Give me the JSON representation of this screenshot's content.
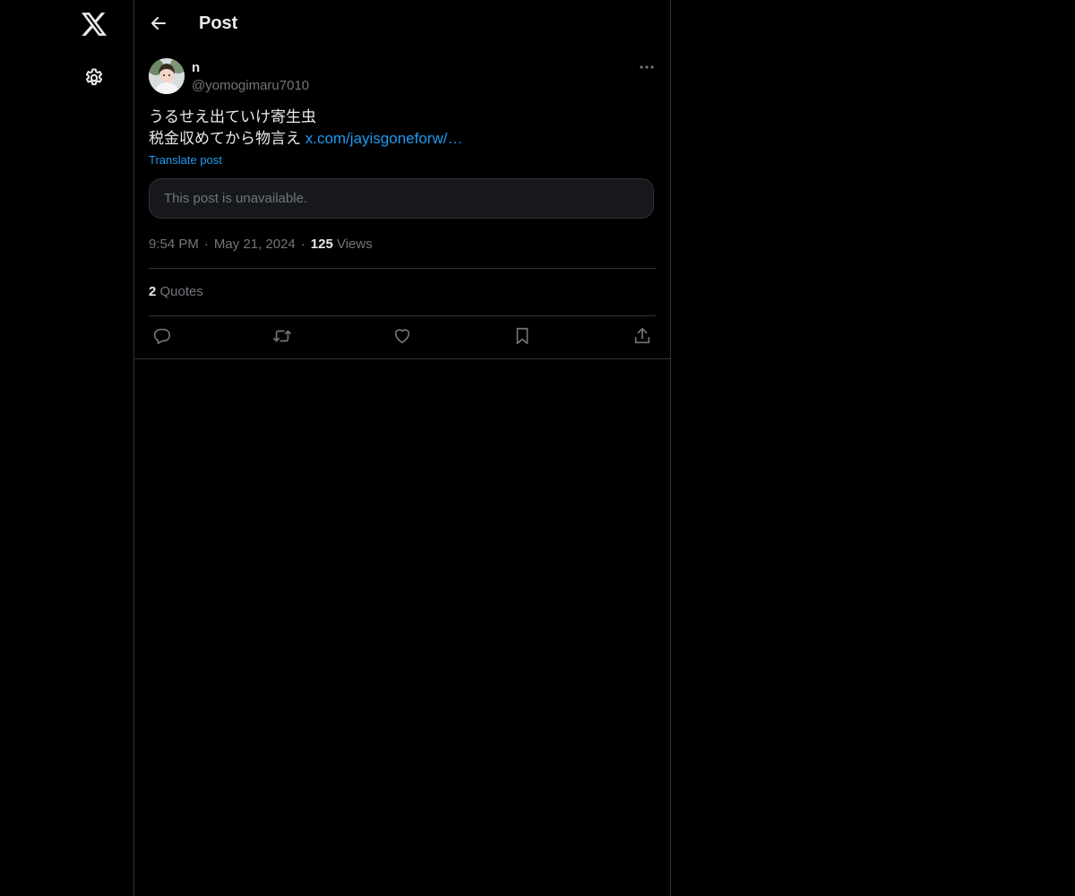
{
  "nav": {
    "logo_icon": "x-logo-icon",
    "settings_icon": "gear-icon"
  },
  "header": {
    "back_icon": "arrow-left-icon",
    "title": "Post"
  },
  "post": {
    "display_name": "n",
    "handle": "@yomogimaru7010",
    "text_line1": "うるせえ出ていけ寄生虫",
    "text_line2": "税金収めてから物言え",
    "link_text": "x.com/jayisgoneforw/…",
    "translate_label": "Translate post",
    "quoted_unavailable": "This post is unavailable.",
    "time": "9:54 PM",
    "date": "May 21, 2024",
    "separator": "·",
    "views_count": "125",
    "views_label": "Views",
    "quotes_count": "2",
    "quotes_label": "Quotes"
  },
  "actions": {
    "reply_icon": "reply-icon",
    "repost_icon": "repost-icon",
    "like_icon": "heart-icon",
    "bookmark_icon": "bookmark-icon",
    "share_icon": "share-icon"
  },
  "colors": {
    "background": "#000000",
    "text_primary": "#e7e9ea",
    "text_secondary": "#71767b",
    "link": "#1d9bf0",
    "border": "#2f3336",
    "card_bg": "#16181c"
  }
}
